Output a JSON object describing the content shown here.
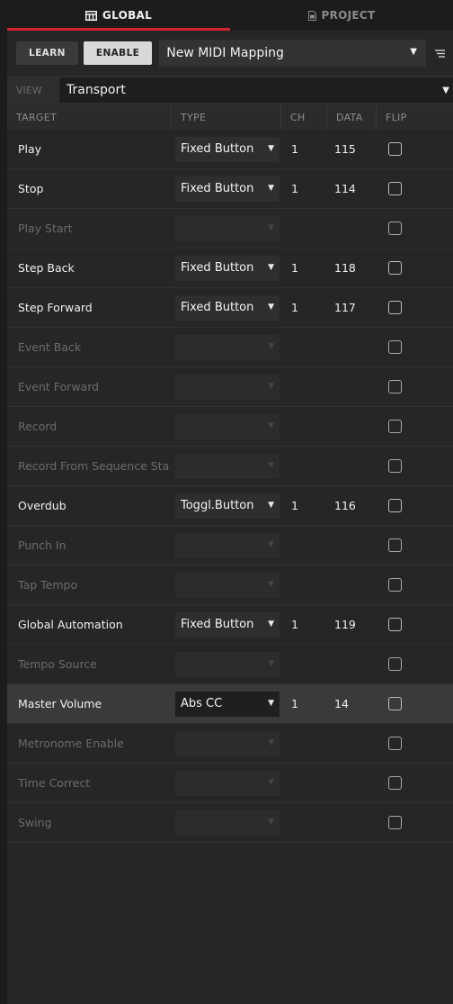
{
  "tabs": [
    {
      "label": "GLOBAL",
      "icon": "grid-icon",
      "active": true
    },
    {
      "label": "PROJECT",
      "icon": "document-icon",
      "active": false
    }
  ],
  "toolbar": {
    "learn_label": "LEARN",
    "enable_label": "ENABLE",
    "mapping_value": "New MIDI Mapping"
  },
  "view": {
    "label": "VIEW",
    "value": "Transport"
  },
  "columns": {
    "target": "TARGET",
    "type": "TYPE",
    "ch": "CH",
    "data": "DATA",
    "flip": "FLIP"
  },
  "rows": [
    {
      "target": "Play",
      "type": "Fixed Button",
      "ch": "1",
      "data": "115",
      "enabled": true,
      "flip": false
    },
    {
      "target": "Stop",
      "type": "Fixed Button",
      "ch": "1",
      "data": "114",
      "enabled": true,
      "flip": false
    },
    {
      "target": "Play Start",
      "type": "",
      "ch": "",
      "data": "",
      "enabled": false,
      "flip": false
    },
    {
      "target": "Step Back",
      "type": "Fixed Button",
      "ch": "1",
      "data": "118",
      "enabled": true,
      "flip": false
    },
    {
      "target": "Step Forward",
      "type": "Fixed Button",
      "ch": "1",
      "data": "117",
      "enabled": true,
      "flip": false
    },
    {
      "target": "Event Back",
      "type": "",
      "ch": "",
      "data": "",
      "enabled": false,
      "flip": false
    },
    {
      "target": "Event Forward",
      "type": "",
      "ch": "",
      "data": "",
      "enabled": false,
      "flip": false
    },
    {
      "target": "Record",
      "type": "",
      "ch": "",
      "data": "",
      "enabled": false,
      "flip": false
    },
    {
      "target": "Record From Sequence Sta",
      "type": "",
      "ch": "",
      "data": "",
      "enabled": false,
      "flip": false
    },
    {
      "target": "Overdub",
      "type": "Toggl.Button",
      "ch": "1",
      "data": "116",
      "enabled": true,
      "flip": false
    },
    {
      "target": "Punch In",
      "type": "",
      "ch": "",
      "data": "",
      "enabled": false,
      "flip": false
    },
    {
      "target": "Tap Tempo",
      "type": "",
      "ch": "",
      "data": "",
      "enabled": false,
      "flip": false
    },
    {
      "target": "Global Automation",
      "type": "Fixed Button",
      "ch": "1",
      "data": "119",
      "enabled": true,
      "flip": false
    },
    {
      "target": "Tempo Source",
      "type": "",
      "ch": "",
      "data": "",
      "enabled": false,
      "flip": false
    },
    {
      "target": "Master Volume",
      "type": "Abs CC",
      "ch": "1",
      "data": "14",
      "enabled": true,
      "flip": false,
      "selected": true
    },
    {
      "target": "Metronome Enable",
      "type": "",
      "ch": "",
      "data": "",
      "enabled": false,
      "flip": false
    },
    {
      "target": "Time Correct",
      "type": "",
      "ch": "",
      "data": "",
      "enabled": false,
      "flip": false
    },
    {
      "target": "Swing",
      "type": "",
      "ch": "",
      "data": "",
      "enabled": false,
      "flip": false
    }
  ],
  "colors": {
    "accent": "#d8222f",
    "background": "#262626",
    "selected_row": "#3a3a3a"
  }
}
